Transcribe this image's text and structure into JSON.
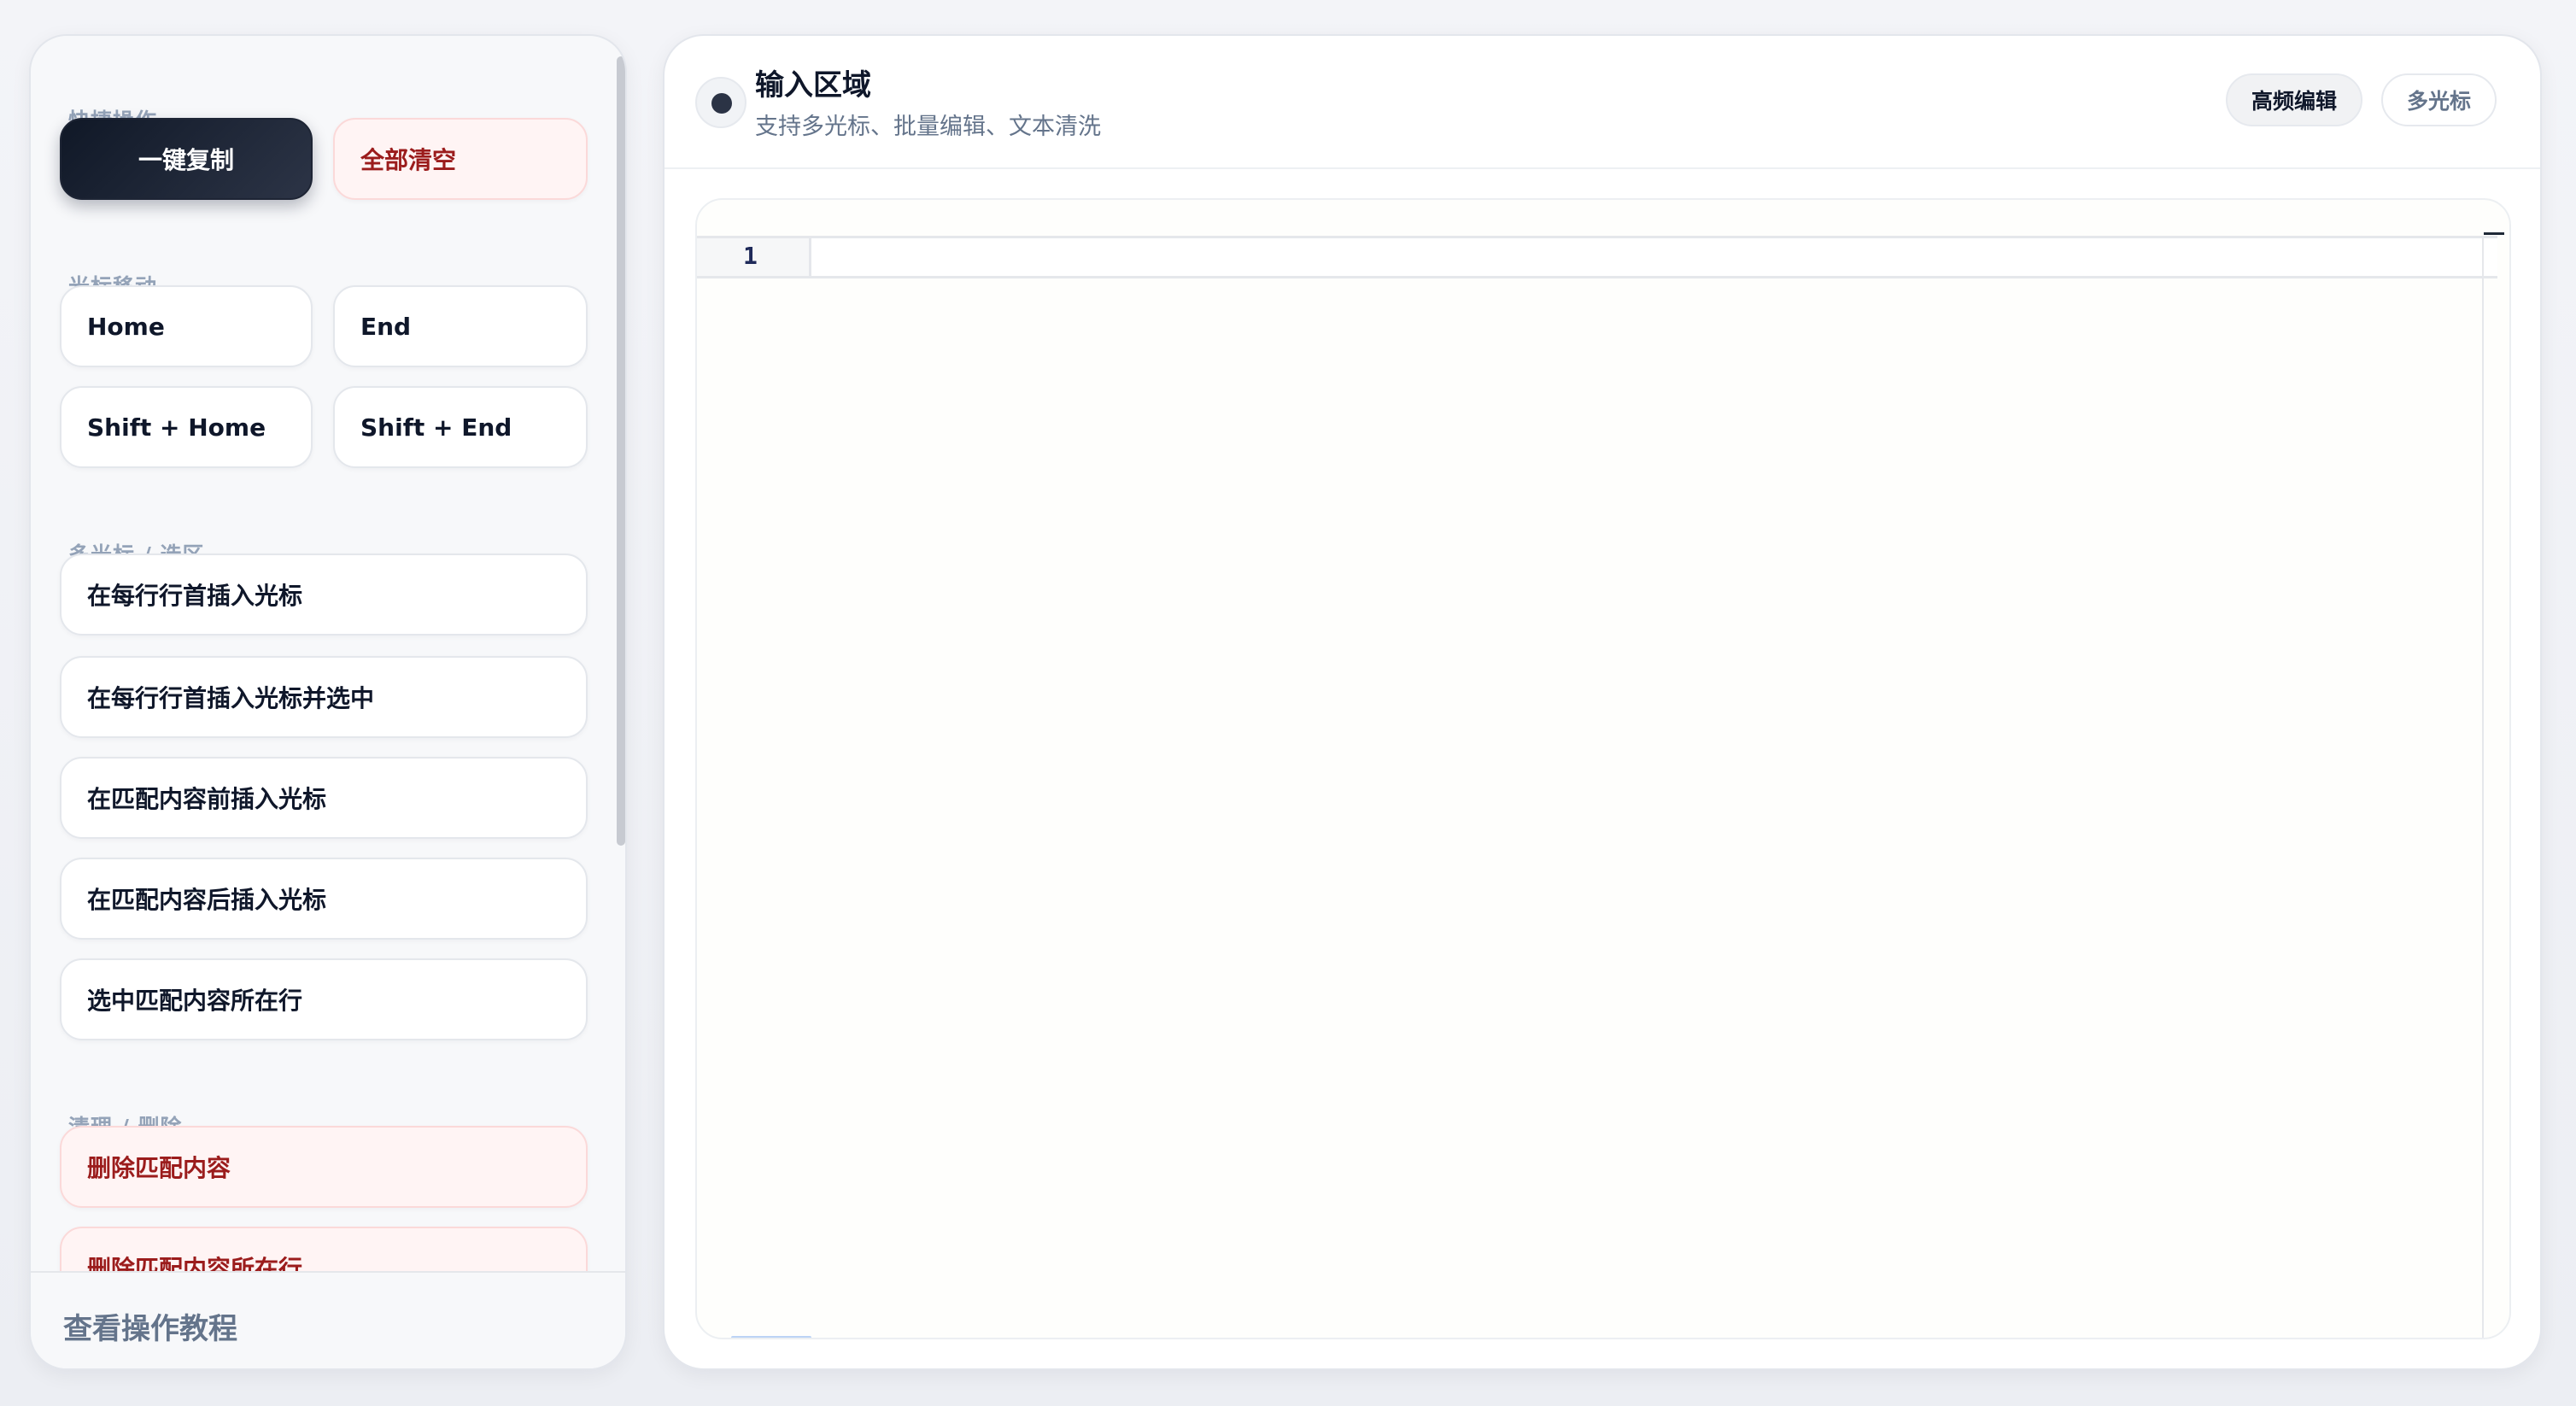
{
  "sidebar": {
    "sections": {
      "quick_actions": "快捷操作",
      "cursor_move": "光标移动",
      "multi_cursor": "多光标 / 选区",
      "cleanup": "清理 / 删除"
    },
    "buttons": {
      "copy_all": "一键复制",
      "clear_all": "全部清空",
      "home": "Home",
      "end": "End",
      "shift_home": "Shift + Home",
      "shift_end": "Shift + End",
      "cursor_each_line_start": "在每行行首插入光标",
      "cursor_each_line_start_select": "在每行行首插入光标并选中",
      "cursor_before_match": "在匹配内容前插入光标",
      "cursor_after_match": "在匹配内容后插入光标",
      "select_match_lines": "选中匹配内容所在行",
      "delete_match": "删除匹配内容",
      "delete_match_lines": "删除匹配内容所在行"
    },
    "footer": {
      "tutorial": "查看操作教程"
    }
  },
  "main": {
    "title": "输入区域",
    "subtitle": "支持多光标、批量编辑、文本清洗",
    "tabs": {
      "frequent": "高频编辑",
      "multi_cursor": "多光标"
    },
    "editor": {
      "line_number": "1"
    }
  },
  "colors": {
    "primary_dark": "#101827",
    "danger_text": "#9b1c1c",
    "danger_bg": "#fff4f4",
    "muted": "#94a3b8"
  }
}
